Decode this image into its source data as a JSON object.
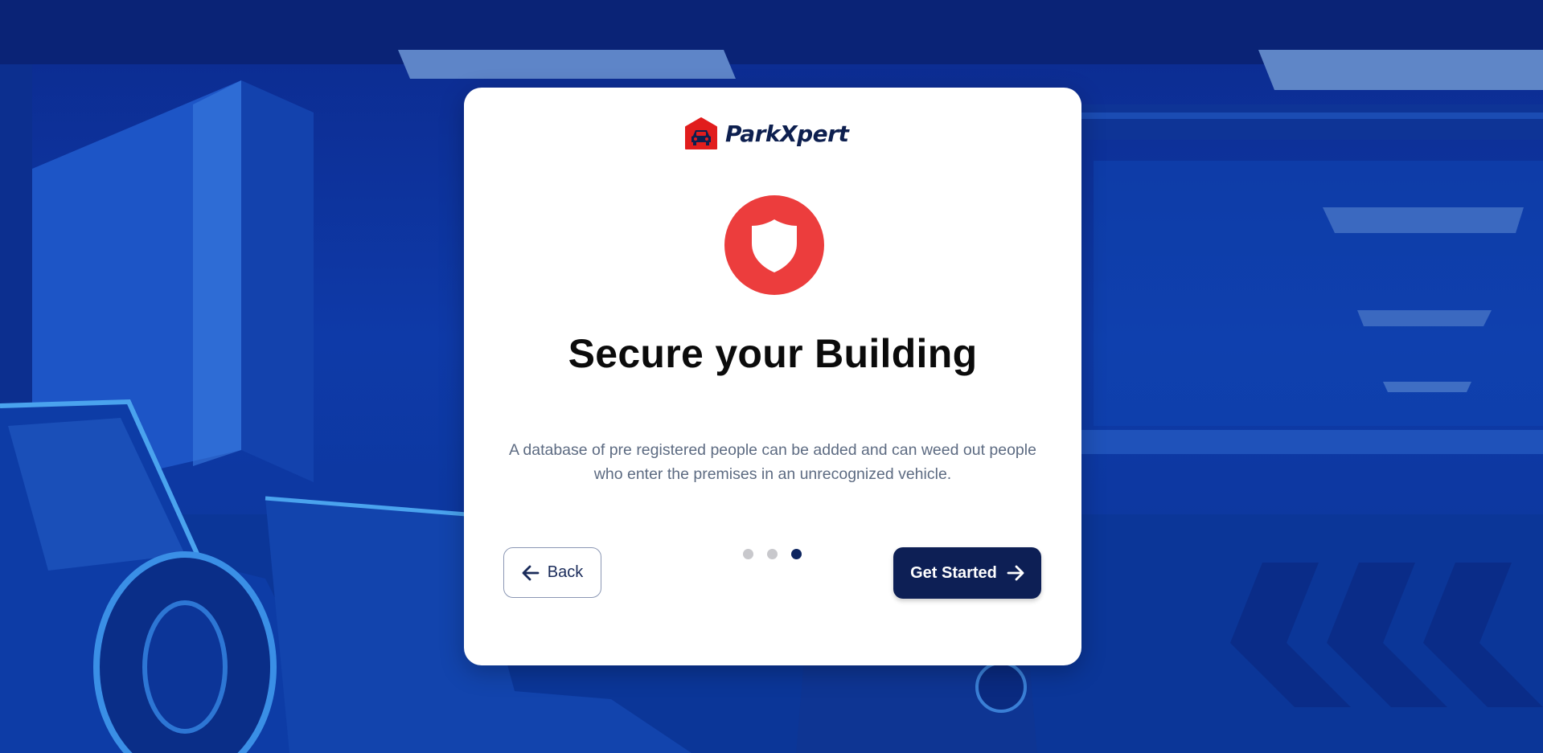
{
  "app": {
    "brand_name": "ParkXpert",
    "logo_icon": "car-garage-icon",
    "brand_color": "#e11d1d",
    "navy": "#0d1f55"
  },
  "onboarding": {
    "icon": "shield-icon",
    "icon_color": "#ec3d3d",
    "title": "Secure your Building",
    "description": "A database of pre registered people can be added and can weed out people who enter the premises in an unrecognized vehicle.",
    "back_label": "Back",
    "back_icon": "arrow-left-icon",
    "next_label": "Get Started",
    "next_icon": "arrow-right-icon",
    "pagination": {
      "total": 3,
      "active": 3
    }
  }
}
